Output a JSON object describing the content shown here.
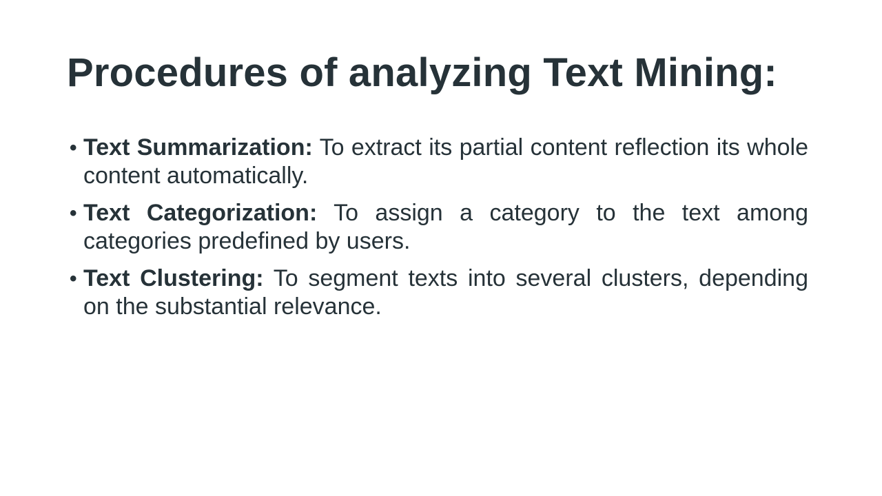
{
  "slide": {
    "title": "Procedures of analyzing Text Mining:",
    "bullets": [
      {
        "term": "Text Summarization:",
        "description": "To extract its partial content reflection its whole content automatically."
      },
      {
        "term": "Text Categorization:",
        "description": "To assign a category to the text among categories predefined by users."
      },
      {
        "term": "Text Clustering:",
        "description": "To segment texts into several clusters, depending on the substantial relevance."
      }
    ],
    "bullet_glyph": "•",
    "colors": {
      "text": "#263238",
      "background": "#ffffff"
    }
  }
}
